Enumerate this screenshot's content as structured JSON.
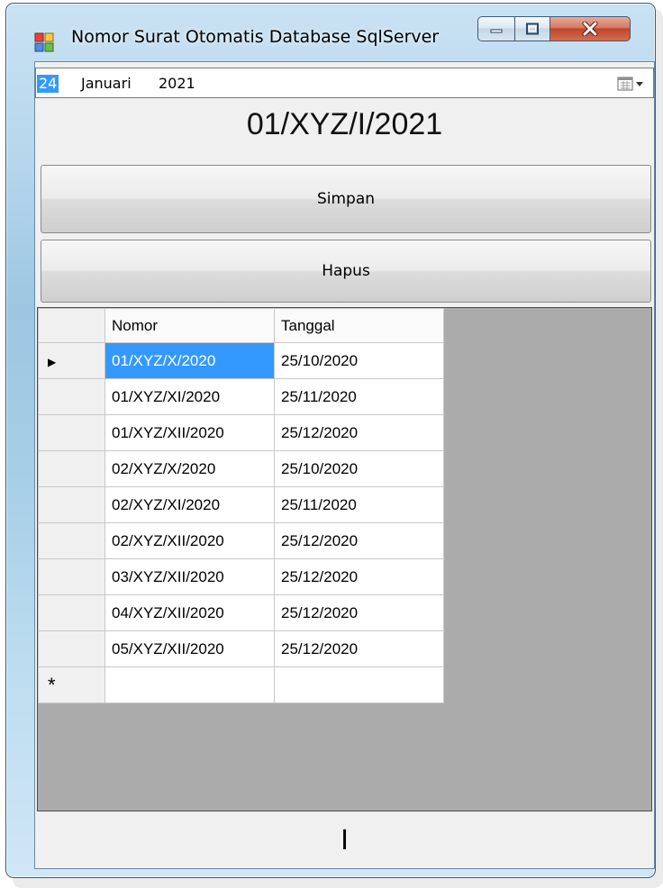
{
  "window": {
    "title": "Nomor Surat Otomatis Database SqlServer",
    "accent_color": "#3399ff",
    "icon": "app-icon"
  },
  "datepicker": {
    "day": "24",
    "month": "Januari",
    "year": "2021",
    "icon": "calendar-dropdown-icon"
  },
  "result": {
    "text": "01/XYZ/I/2021"
  },
  "buttons": {
    "save_label": "Simpan",
    "delete_label": "Hapus"
  },
  "grid": {
    "columns": [
      "Nomor",
      "Tanggal"
    ],
    "rows": [
      {
        "nomor": "01/XYZ/X/2020",
        "tanggal": "25/10/2020"
      },
      {
        "nomor": "01/XYZ/XI/2020",
        "tanggal": "25/11/2020"
      },
      {
        "nomor": "01/XYZ/XII/2020",
        "tanggal": "25/12/2020"
      },
      {
        "nomor": "02/XYZ/X/2020",
        "tanggal": "25/10/2020"
      },
      {
        "nomor": "02/XYZ/XI/2020",
        "tanggal": "25/11/2020"
      },
      {
        "nomor": "02/XYZ/XII/2020",
        "tanggal": "25/12/2020"
      },
      {
        "nomor": "03/XYZ/XII/2020",
        "tanggal": "25/12/2020"
      },
      {
        "nomor": "04/XYZ/XII/2020",
        "tanggal": "25/12/2020"
      },
      {
        "nomor": "05/XYZ/XII/2020",
        "tanggal": "25/12/2020"
      }
    ],
    "current_row_marker": "▶",
    "new_row_marker": "*"
  },
  "status": {
    "text": "I"
  }
}
